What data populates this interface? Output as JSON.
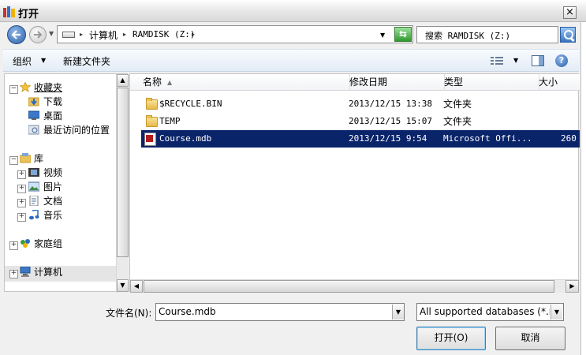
{
  "window": {
    "title": "打开",
    "close_label": "×"
  },
  "address_bar": {
    "crumbs": [
      "计算机",
      "RAMDISK (Z:)"
    ],
    "separator": "▸",
    "dropdown": "▼"
  },
  "search": {
    "placeholder": "搜索 RAMDISK (Z:)"
  },
  "toolbar": {
    "organize_label": "组织",
    "organize_arrow": "▼",
    "new_folder_label": "新建文件夹",
    "view_arrow": "▼",
    "help_label": "?"
  },
  "nav": {
    "favorites": {
      "label": "收藏夹",
      "items": [
        {
          "label": "下载",
          "icon": "download-folder-icon"
        },
        {
          "label": "桌面",
          "icon": "desktop-icon"
        },
        {
          "label": "最近访问的位置",
          "icon": "recent-places-icon"
        }
      ]
    },
    "libraries": {
      "label": "库",
      "items": [
        {
          "label": "视频",
          "icon": "video-icon"
        },
        {
          "label": "图片",
          "icon": "pictures-icon"
        },
        {
          "label": "文档",
          "icon": "documents-icon"
        },
        {
          "label": "音乐",
          "icon": "music-icon"
        }
      ]
    },
    "homegroup": {
      "label": "家庭组"
    },
    "computer": {
      "label": "计算机"
    },
    "expander_collapsed": "+",
    "expander_expanded": "−"
  },
  "file_list": {
    "columns": {
      "name": "名称",
      "date": "修改日期",
      "type": "类型",
      "size": "大小"
    },
    "sort_indicator": "▲",
    "rows": [
      {
        "name": "$RECYCLE.BIN",
        "date": "2013/12/15 13:38",
        "type": "文件夹",
        "size": "",
        "icon": "folder-icon",
        "selected": false
      },
      {
        "name": "TEMP",
        "date": "2013/12/15 15:07",
        "type": "文件夹",
        "size": "",
        "icon": "folder-icon",
        "selected": false
      },
      {
        "name": "Course.mdb",
        "date": "2013/12/15 9:54",
        "type": "Microsoft Offi...",
        "size": "260",
        "icon": "access-database-icon",
        "selected": true
      }
    ]
  },
  "scroll": {
    "up": "▲",
    "down": "▼",
    "left": "◀",
    "right": "▶"
  },
  "bottom": {
    "filename_label": "文件名(N):",
    "filename_value": "Course.mdb",
    "filetype_value": "All supported databases (*.mdb",
    "open_label": "打开(O)",
    "cancel_label": "取消"
  }
}
